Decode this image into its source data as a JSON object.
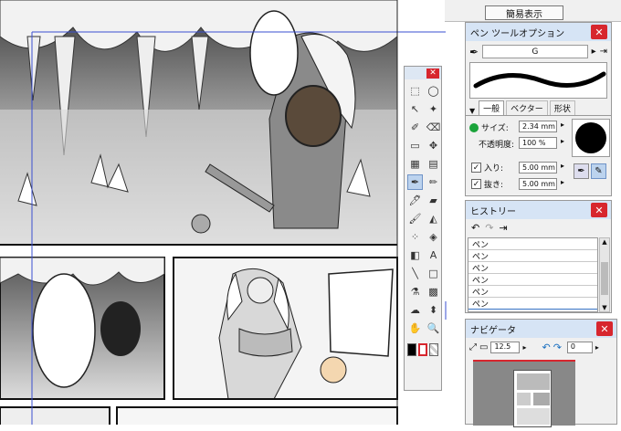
{
  "top_bar": {
    "display_button": "簡易表示"
  },
  "pen_options": {
    "title": "ペン ツールオプション",
    "brush_name": "G",
    "tabs": [
      "一般",
      "ベクター",
      "形状"
    ],
    "size_label": "サイズ:",
    "size_value": "2.34 mm",
    "opacity_label": "不透明度:",
    "opacity_value": "100 %",
    "in_label": "入り:",
    "in_value": "5.00 mm",
    "out_label": "抜き:",
    "out_value": "5.00 mm"
  },
  "history": {
    "title": "ヒストリー",
    "items": [
      "ペン",
      "ペン",
      "ペン",
      "ペン",
      "ペン",
      "ペン",
      "ペン"
    ]
  },
  "navigator": {
    "title": "ナビゲータ",
    "zoom": "12.5",
    "rotation": "0"
  },
  "colors": {
    "accent": "#d7262e",
    "title_bar": "#d6e4f5",
    "selection": "#bcd3ee"
  }
}
